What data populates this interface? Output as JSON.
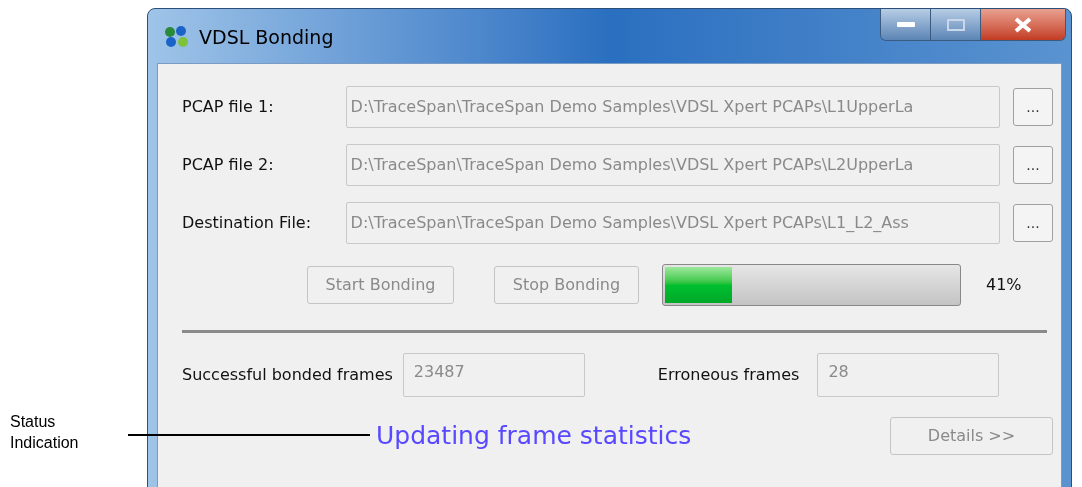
{
  "annotation": {
    "text": "Status Indication"
  },
  "window": {
    "title": "VDSL Bonding"
  },
  "file_rows": [
    {
      "label": "PCAP file 1:",
      "value": "D:\\TraceSpan\\TraceSpan Demo Samples\\VDSL Xpert PCAPs\\L1UpperLa",
      "disabled": true,
      "browse": "..."
    },
    {
      "label": "PCAP file 2:",
      "value": "D:\\TraceSpan\\TraceSpan Demo Samples\\VDSL Xpert PCAPs\\L2UpperLa",
      "disabled": true,
      "browse": "..."
    },
    {
      "label": "Destination File:",
      "value": "D:\\TraceSpan\\TraceSpan Demo Samples\\VDSL Xpert PCAPs\\L1_L2_Ass",
      "disabled": true,
      "browse": "..."
    }
  ],
  "actions": [
    {
      "label": "Start Bonding",
      "disabled": true
    },
    {
      "label": "Stop Bonding",
      "disabled": true
    }
  ],
  "progress": {
    "level": 0.23,
    "reading": "41%"
  },
  "stats": [
    {
      "label": "Successful bonded frames",
      "value": "23487"
    },
    {
      "label": "Erroneous frames",
      "value": "28"
    }
  ],
  "status": {
    "text": "Updating frame statistics"
  },
  "details_button": {
    "label": "Details >>",
    "disabled": true
  }
}
